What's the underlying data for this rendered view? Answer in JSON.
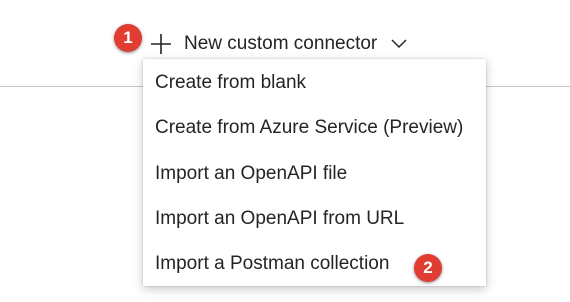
{
  "header": {
    "new_connector_label": "New custom connector",
    "plus_icon": "plus-icon",
    "chevron_icon": "chevron-down-icon"
  },
  "badges": {
    "step1": "1",
    "step2": "2",
    "color": "#e03c31"
  },
  "menu": {
    "items": [
      {
        "label": "Create from blank"
      },
      {
        "label": "Create from Azure Service (Preview)"
      },
      {
        "label": "Import an OpenAPI file"
      },
      {
        "label": "Import an OpenAPI from URL"
      },
      {
        "label": "Import a Postman collection"
      }
    ]
  }
}
